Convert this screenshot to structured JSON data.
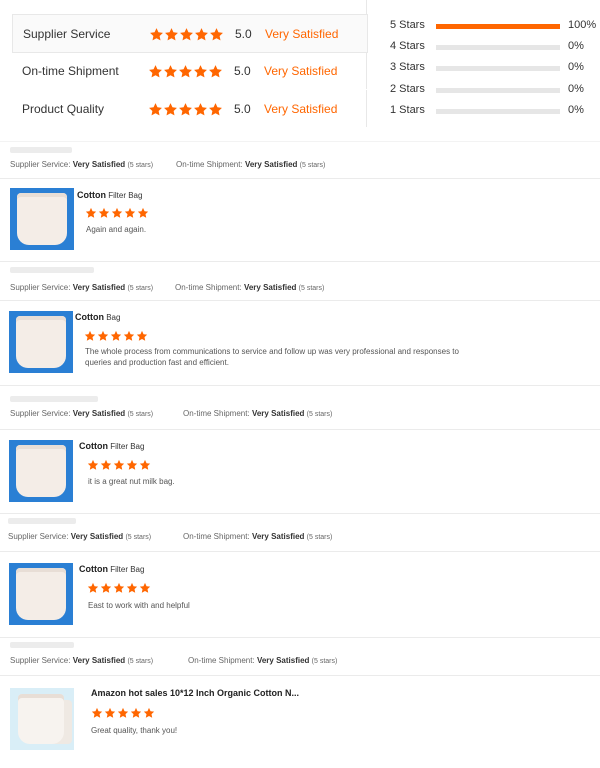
{
  "colors": {
    "accent": "#ff6600",
    "star": "#ff6600"
  },
  "summary": {
    "rows": [
      {
        "label": "Supplier Service",
        "stars": 5,
        "score": "5.0",
        "verdict": "Very Satisfied"
      },
      {
        "label": "On-time Shipment",
        "stars": 5,
        "score": "5.0",
        "verdict": "Very Satisfied"
      },
      {
        "label": "Product Quality",
        "stars": 5,
        "score": "5.0",
        "verdict": "Very Satisfied"
      }
    ]
  },
  "distribution": [
    {
      "label": "5  Stars",
      "percent": "100%",
      "fraction": 1.0
    },
    {
      "label": "4  Stars",
      "percent": "0%",
      "fraction": 0
    },
    {
      "label": "3  Stars",
      "percent": "0%",
      "fraction": 0
    },
    {
      "label": "2  Stars",
      "percent": "0%",
      "fraction": 0
    },
    {
      "label": "1  Stars",
      "percent": "0%",
      "fraction": 0
    }
  ],
  "reviews": [
    {
      "service_label": "Supplier Service:",
      "service_value": "Very Satisfied",
      "service_stars": "(5 stars)",
      "shipment_label": "On-time Shipment:",
      "shipment_value": "Very Satisfied",
      "shipment_stars": "(5 stars)",
      "product_bold": "Cotton",
      "product_rest": " Filter Bag",
      "rating": 5,
      "comment": "Again and again.",
      "thumb_icon": "filter-bag-image"
    },
    {
      "service_label": "Supplier Service:",
      "service_value": "Very Satisfied",
      "service_stars": "(5 stars)",
      "shipment_label": "On-time Shipment:",
      "shipment_value": "Very Satisfied",
      "shipment_stars": "(5 stars)",
      "product_bold": "Cotton",
      "product_rest": "  Bag",
      "rating": 5,
      "comment": "The whole process from communications to service and follow up was very professional and responses to queries and production fast and efficient.",
      "thumb_icon": "filter-bag-image"
    },
    {
      "service_label": "Supplier Service:",
      "service_value": "Very Satisfied",
      "service_stars": "(5 stars)",
      "shipment_label": "On-time Shipment:",
      "shipment_value": "Very Satisfied",
      "shipment_stars": "(5 stars)",
      "product_bold": "Cotton",
      "product_rest": " Filter Bag",
      "rating": 5,
      "comment": "it is a great nut milk bag.",
      "thumb_icon": "filter-bag-image"
    },
    {
      "service_label": "Supplier Service:",
      "service_value": "Very Satisfied",
      "service_stars": "(5 stars)",
      "shipment_label": "On-time Shipment:",
      "shipment_value": "Very Satisfied",
      "shipment_stars": "(5 stars)",
      "product_bold": "Cotton",
      "product_rest": " Filter Bag",
      "rating": 5,
      "comment": "East to work with and helpful",
      "thumb_icon": "filter-bag-image"
    },
    {
      "service_label": "Supplier Service:",
      "service_value": "Very Satisfied",
      "service_stars": "(5 stars)",
      "shipment_label": "On-time Shipment:",
      "shipment_value": "Very Satisfied",
      "shipment_stars": "(5 stars)",
      "product_bold": "Amazon hot sales 10*12 Inch Organic Cotton N...",
      "product_rest": "",
      "rating": 5,
      "comment": "Great quality, thank you!",
      "thumb_icon": "filter-bag-image"
    }
  ]
}
